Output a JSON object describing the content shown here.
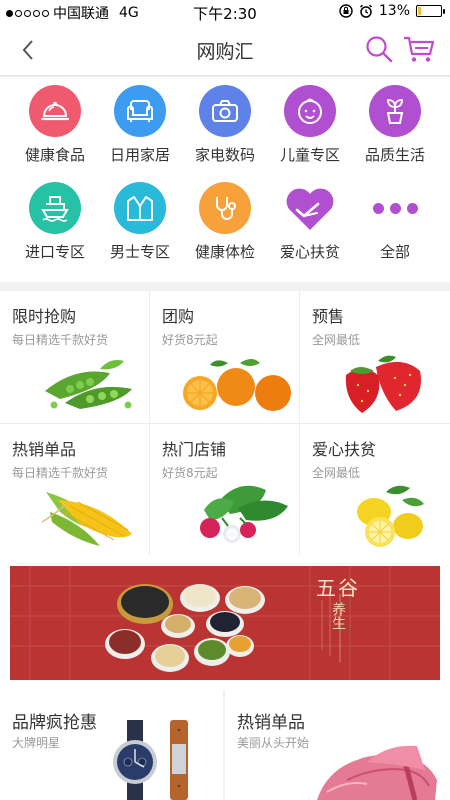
{
  "status_bar": {
    "carrier": "中国联通",
    "network": "4G",
    "time": "下午2:30",
    "battery_percent": "13%",
    "battery_level": 0.13
  },
  "nav": {
    "title": "网购汇",
    "accent_color": "#c04bcf"
  },
  "categories": [
    {
      "label": "健康食品",
      "icon": "cloche-icon",
      "color": "#ef5a6f"
    },
    {
      "label": "日用家居",
      "icon": "sofa-icon",
      "color": "#3d9cf0"
    },
    {
      "label": "家电数码",
      "icon": "camera-icon",
      "color": "#5e82e8"
    },
    {
      "label": "儿童专区",
      "icon": "baby-face-icon",
      "color": "#b04fd0"
    },
    {
      "label": "品质生活",
      "icon": "plant-icon",
      "color": "#b04fd0"
    },
    {
      "label": "进口专区",
      "icon": "ship-icon",
      "color": "#27c2a5"
    },
    {
      "label": "男士专区",
      "icon": "suit-icon",
      "color": "#29b9d9"
    },
    {
      "label": "健康体检",
      "icon": "stethoscope-icon",
      "color": "#f6a13a"
    },
    {
      "label": "爱心扶贫",
      "icon": "heart-hand-icon",
      "color": "#b04fd0"
    },
    {
      "label": "全部",
      "icon": "more-dots-icon",
      "color": "#b04fd0"
    }
  ],
  "grid": [
    {
      "title": "限时抢购",
      "subtitle": "每日精选千款好货",
      "image": "peas-image"
    },
    {
      "title": "团购",
      "subtitle": "好货8元起",
      "image": "oranges-image"
    },
    {
      "title": "预售",
      "subtitle": "全网最低",
      "image": "strawberries-image"
    },
    {
      "title": "热销单品",
      "subtitle": "每日精选千款好货",
      "image": "corn-image"
    },
    {
      "title": "热门店铺",
      "subtitle": "好货8元起",
      "image": "radish-image"
    },
    {
      "title": "爱心扶贫",
      "subtitle": "全网最低",
      "image": "lemons-image"
    }
  ],
  "banner": {
    "heading": "五谷",
    "subheading": "养生",
    "image": "grains-bowls-image"
  },
  "bottom_cards": [
    {
      "title": "品牌疯抢惠",
      "subtitle": "大牌明星",
      "image": "watches-image"
    },
    {
      "title": "热销单品",
      "subtitle": "美丽从头开始",
      "image": "high-heels-image"
    }
  ]
}
